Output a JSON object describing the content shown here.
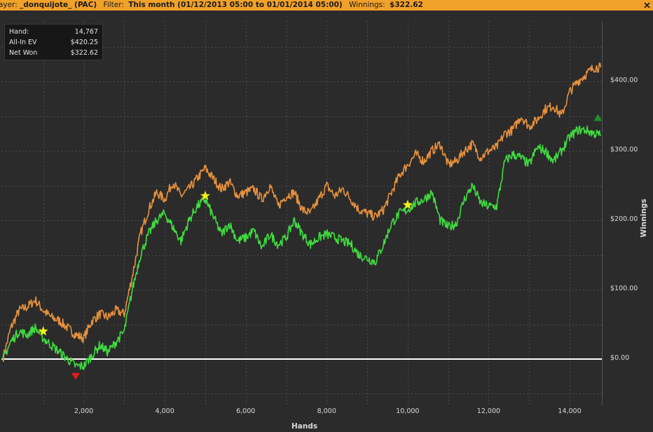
{
  "header": {
    "player_label": "ayer:",
    "player_value": "_donquijote_ (PAC)",
    "filter_label": "Filter:",
    "filter_value": "This month (01/12/2013 05:00 to 01/01/2014 05:00)",
    "winnings_label": "Winnings:",
    "winnings_value": "$322.62"
  },
  "stats": {
    "hand_label": "Hand:",
    "hand_value": "14,767",
    "ev_label": "All-In EV",
    "ev_value": "$420.25",
    "net_label": "Net Won",
    "net_value": "$322.62"
  },
  "colors": {
    "background": "#2b2b2b",
    "title_bar": "#f0a12a",
    "ev_line": "#e8913d",
    "net_line": "#3fdc3f",
    "zero_line": "#ffffff",
    "star": "#f2f21a",
    "down_marker": "#e01b1b",
    "up_marker": "#1f8f2a"
  },
  "chart_data": {
    "type": "line",
    "xlabel": "Hands",
    "ylabel": "Winnings",
    "xlim": [
      0,
      14767
    ],
    "ylim": [
      -70,
      470
    ],
    "xticks": [
      2000,
      4000,
      6000,
      8000,
      10000,
      12000,
      14000
    ],
    "xtick_labels": [
      "2,000",
      "4,000",
      "6,000",
      "8,000",
      "10,000",
      "12,000",
      "14,000"
    ],
    "yticks": [
      0,
      100,
      200,
      300,
      400
    ],
    "ytick_labels": [
      "$0.00",
      "$100.00",
      "$200.00",
      "$300.00",
      "$400.00"
    ],
    "grid": true,
    "series": [
      {
        "key": "ev",
        "x": [
          0,
          200,
          400,
          600,
          800,
          1000,
          1200,
          1400,
          1600,
          1800,
          2000,
          2200,
          2400,
          2600,
          2800,
          3000,
          3200,
          3400,
          3600,
          3800,
          4000,
          4200,
          4400,
          4600,
          4800,
          5000,
          5200,
          5400,
          5600,
          5800,
          6000,
          6200,
          6400,
          6600,
          6800,
          7000,
          7200,
          7400,
          7600,
          7800,
          8000,
          8200,
          8400,
          8600,
          8800,
          9000,
          9200,
          9400,
          9600,
          9800,
          10000,
          10200,
          10400,
          10600,
          10800,
          11000,
          11200,
          11400,
          11600,
          11800,
          12000,
          12200,
          12400,
          12600,
          12800,
          13000,
          13200,
          13400,
          13600,
          13800,
          14000,
          14200,
          14400,
          14600,
          14767
        ],
        "y": [
          0,
          45,
          70,
          75,
          85,
          70,
          60,
          55,
          45,
          35,
          30,
          55,
          65,
          60,
          70,
          65,
          120,
          180,
          215,
          240,
          230,
          255,
          235,
          245,
          260,
          275,
          260,
          245,
          255,
          235,
          240,
          245,
          230,
          250,
          220,
          235,
          240,
          215,
          210,
          230,
          250,
          235,
          245,
          230,
          215,
          210,
          205,
          215,
          240,
          265,
          280,
          295,
          285,
          300,
          310,
          280,
          285,
          300,
          310,
          290,
          300,
          305,
          325,
          330,
          350,
          335,
          345,
          360,
          365,
          350,
          385,
          400,
          410,
          420,
          420
        ]
      },
      {
        "key": "net",
        "x": [
          0,
          200,
          400,
          600,
          800,
          1000,
          1200,
          1400,
          1600,
          1800,
          2000,
          2200,
          2400,
          2600,
          2800,
          3000,
          3200,
          3400,
          3600,
          3800,
          4000,
          4200,
          4400,
          4600,
          4800,
          5000,
          5200,
          5400,
          5600,
          5800,
          6000,
          6200,
          6400,
          6600,
          6800,
          7000,
          7200,
          7400,
          7600,
          7800,
          8000,
          8200,
          8400,
          8600,
          8800,
          9000,
          9200,
          9400,
          9600,
          9800,
          10000,
          10200,
          10400,
          10600,
          10800,
          11000,
          11200,
          11400,
          11600,
          11800,
          12000,
          12200,
          12400,
          12600,
          12800,
          13000,
          13200,
          13400,
          13600,
          13800,
          14000,
          14200,
          14400,
          14600,
          14767
        ],
        "y": [
          0,
          25,
          40,
          35,
          45,
          30,
          20,
          10,
          0,
          -10,
          -10,
          5,
          20,
          10,
          25,
          40,
          100,
          150,
          180,
          200,
          210,
          190,
          170,
          200,
          220,
          230,
          205,
          180,
          195,
          170,
          175,
          185,
          160,
          180,
          165,
          175,
          200,
          180,
          165,
          175,
          180,
          175,
          170,
          165,
          150,
          145,
          140,
          165,
          195,
          210,
          215,
          225,
          230,
          240,
          200,
          190,
          195,
          230,
          250,
          225,
          220,
          220,
          285,
          295,
          290,
          280,
          305,
          300,
          285,
          300,
          320,
          330,
          330,
          325,
          323
        ]
      }
    ],
    "annotations": [
      {
        "type": "star",
        "x": 1000,
        "y": 40
      },
      {
        "type": "star",
        "x": 5000,
        "y": 235
      },
      {
        "type": "star",
        "x": 10000,
        "y": 222
      },
      {
        "type": "triangle-down",
        "x": 1800,
        "y": -25
      },
      {
        "type": "triangle-up",
        "x": 14700,
        "y": 348
      }
    ]
  }
}
